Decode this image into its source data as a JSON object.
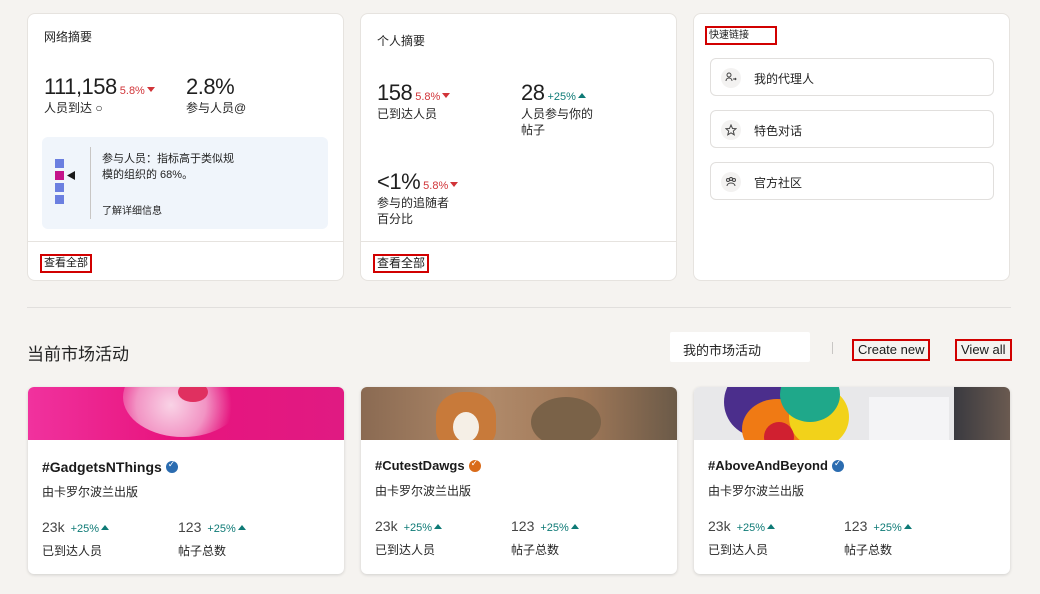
{
  "network_summary": {
    "title": "网络摘要",
    "reach": {
      "value": "111,158",
      "change": "5.8%",
      "label": "人员到达"
    },
    "engaged": {
      "value": "2.8%",
      "label": "参与人员"
    },
    "insight": {
      "text": "参与人员：指标高于类似规模的组织的 68%。",
      "link": "了解详细信息"
    },
    "view_all": "查看全部"
  },
  "personal_summary": {
    "title": "个人摘要",
    "reached": {
      "value": "158",
      "change": "5.8%",
      "label": "已到达人员"
    },
    "engaged": {
      "value": "28",
      "change": "+25%",
      "label": "人员参与你的帖子"
    },
    "followers": {
      "value": "<1%",
      "change": "5.8%",
      "label": "参与的追随者百分比"
    },
    "view_all": "查看全部"
  },
  "quick_links": {
    "title": "快速链接",
    "items": [
      {
        "label": "我的代理人",
        "icon": "people-swap-icon"
      },
      {
        "label": "特色对话",
        "icon": "star-icon"
      },
      {
        "label": "官方社区",
        "icon": "community-icon"
      }
    ]
  },
  "campaigns": {
    "title": "当前市场活动",
    "tab": "我的市场活动",
    "create_new": "Create new",
    "view_all": "View all",
    "items": [
      {
        "tag": "#GadgetsNThings",
        "verify_color": "#2b6cb0",
        "by": "由卡罗尔波兰出版",
        "reach": "23k",
        "reach_change": "+25%",
        "reach_label": "已到达人员",
        "posts": "123",
        "posts_change": "+25%",
        "posts_label": "帖子总数"
      },
      {
        "tag": "#CutestDawgs",
        "verify_color": "#d96b1a",
        "by": "由卡罗尔波兰出版",
        "reach": "23k",
        "reach_change": "+25%",
        "reach_label": "已到达人员",
        "posts": "123",
        "posts_change": "+25%",
        "posts_label": "帖子总数"
      },
      {
        "tag": "#AboveAndBeyond",
        "verify_color": "#2b6cb0",
        "by": "由卡罗尔波兰出版",
        "reach": "23k",
        "reach_change": "+25%",
        "reach_label": "已到达人员",
        "posts": "123",
        "posts_change": "+25%",
        "posts_label": "帖子总数"
      }
    ]
  }
}
